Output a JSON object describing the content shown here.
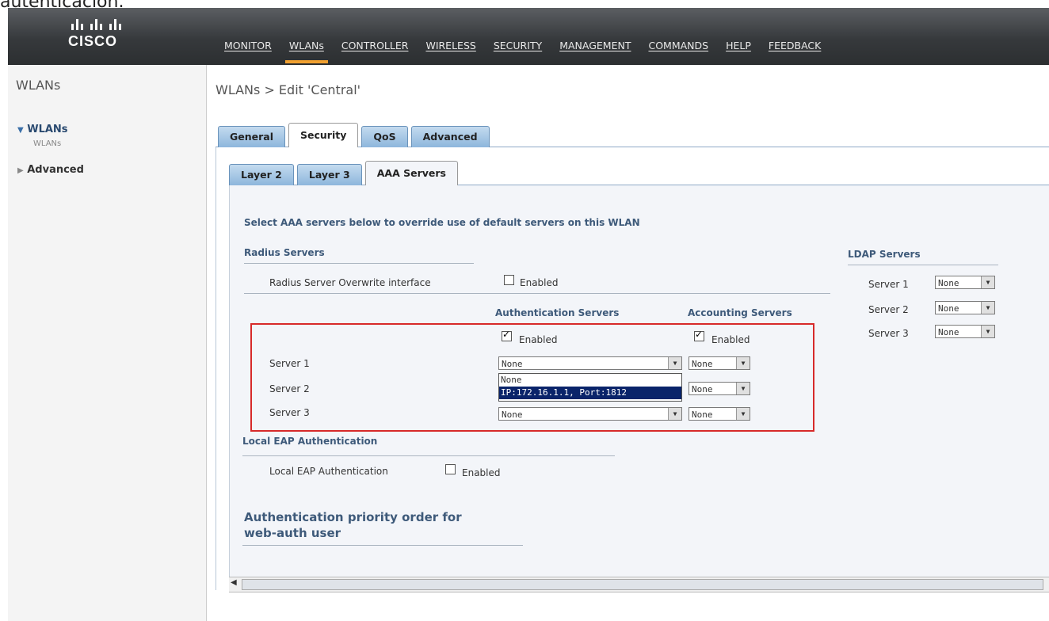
{
  "caption": "autenticación.",
  "brand": {
    "name": "CISCO"
  },
  "nav": [
    "MONITOR",
    "WLANs",
    "CONTROLLER",
    "WIRELESS",
    "SECURITY",
    "MANAGEMENT",
    "COMMANDS",
    "HELP",
    "FEEDBACK"
  ],
  "nav_active": "WLANs",
  "sidebar": {
    "title": "WLANs",
    "items": [
      {
        "label": "WLANs",
        "expanded": true,
        "children": [
          "WLANs"
        ]
      },
      {
        "label": "Advanced",
        "expanded": false
      }
    ]
  },
  "page": {
    "title": "WLANs > Edit  'Central'",
    "tabs": [
      "General",
      "Security",
      "QoS",
      "Advanced"
    ],
    "active_tab": "Security",
    "subtabs": [
      "Layer 2",
      "Layer 3",
      "AAA Servers"
    ],
    "active_subtab": "AAA Servers"
  },
  "aaa": {
    "intro": "Select AAA servers below to override use of default servers on this WLAN",
    "radius_title": "Radius Servers",
    "overwrite_label": "Radius Server Overwrite interface",
    "overwrite_enabled_label": "Enabled",
    "auth_header": "Authentication Servers",
    "acct_header": "Accounting Servers",
    "auth_enabled_label": "Enabled",
    "acct_enabled_label": "Enabled",
    "servers": [
      {
        "label": "Server 1",
        "auth": "None",
        "acct": "None"
      },
      {
        "label": "Server 2",
        "auth": "",
        "acct": "None"
      },
      {
        "label": "Server 3",
        "auth": "None",
        "acct": "None"
      }
    ],
    "dropdown_options": [
      "None",
      "IP:172.16.1.1, Port:1812"
    ],
    "dropdown_selected": "IP:172.16.1.1, Port:1812",
    "ldap_title": "LDAP Servers",
    "ldap_servers": [
      {
        "label": "Server 1",
        "value": "None"
      },
      {
        "label": "Server 2",
        "value": "None"
      },
      {
        "label": "Server 3",
        "value": "None"
      }
    ],
    "local_eap_title": "Local EAP Authentication",
    "local_eap_label": "Local EAP Authentication",
    "local_eap_enabled_label": "Enabled",
    "priority_title_1": "Authentication priority order for",
    "priority_title_2": "web-auth user"
  },
  "colors": {
    "tab_blue": "#8db6dc",
    "highlight_box": "#d72a2a",
    "nav_accent": "#f0a030"
  }
}
